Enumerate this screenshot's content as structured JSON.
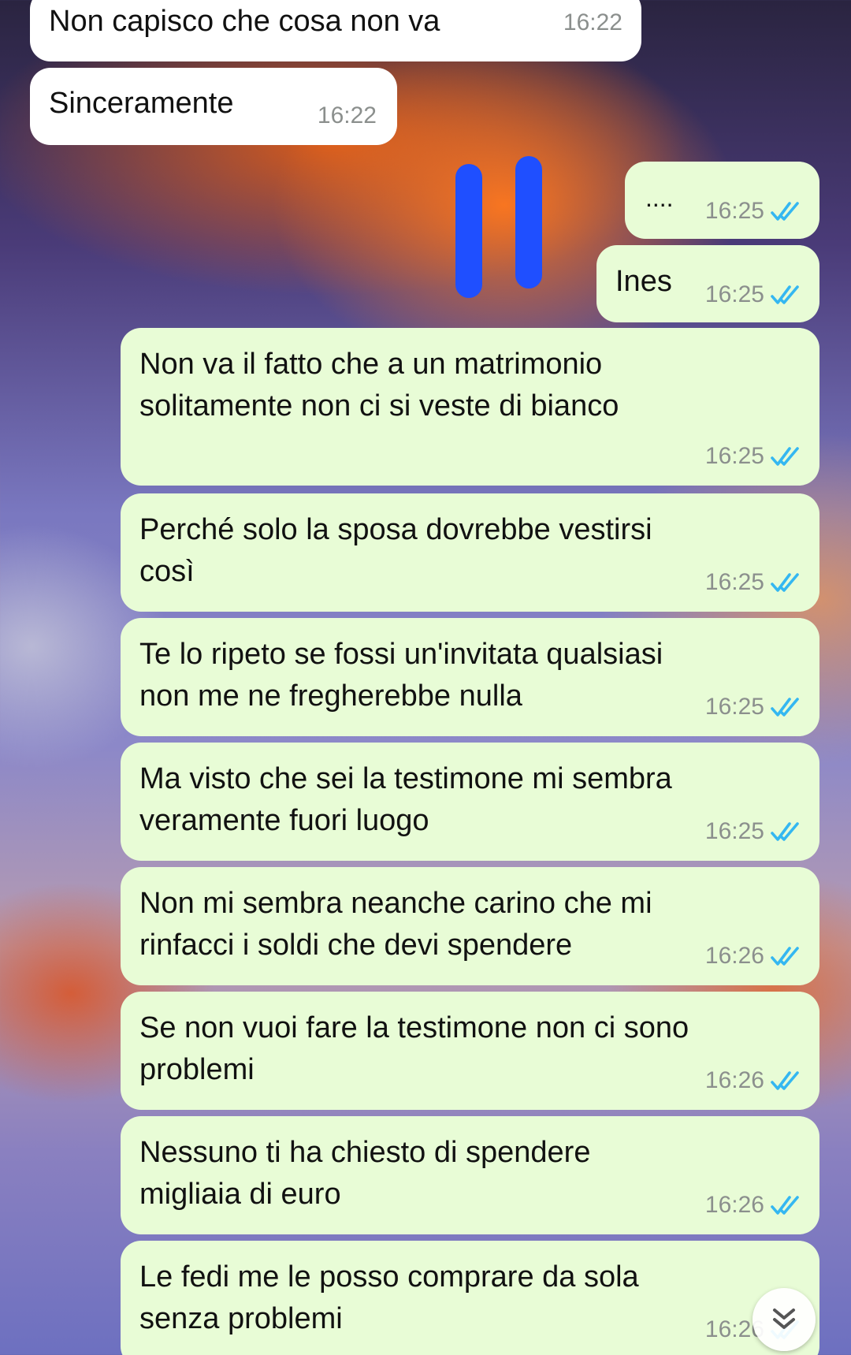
{
  "chat": {
    "messages": [
      {
        "direction": "incoming",
        "text": "Non capisco che cosa non va",
        "time": "16:22"
      },
      {
        "direction": "incoming",
        "text": "Sinceramente",
        "time": "16:22"
      },
      {
        "direction": "outgoing",
        "text": "....",
        "time": "16:25",
        "status": "read"
      },
      {
        "direction": "outgoing",
        "text": "Ines",
        "time": "16:25",
        "status": "read"
      },
      {
        "direction": "outgoing",
        "text": "Non va il fatto che a un matrimonio\nsolitamente non ci si veste di bianco",
        "time": "16:25",
        "status": "read"
      },
      {
        "direction": "outgoing",
        "text": "Perché solo la sposa dovrebbe vestirsi\ncosì",
        "time": "16:25",
        "status": "read"
      },
      {
        "direction": "outgoing",
        "text": "Te lo ripeto se fossi un'invitata qualsiasi\nnon me ne fregherebbe nulla",
        "time": "16:25",
        "status": "read"
      },
      {
        "direction": "outgoing",
        "text": "Ma visto che sei la testimone mi sembra\nveramente fuori luogo",
        "time": "16:25",
        "status": "read"
      },
      {
        "direction": "outgoing",
        "text": "Non mi sembra neanche carino che mi\nrinfacci i soldi che devi spendere",
        "time": "16:26",
        "status": "read"
      },
      {
        "direction": "outgoing",
        "text": "Se non vuoi fare la testimone non ci sono\nproblemi",
        "time": "16:26",
        "status": "read"
      },
      {
        "direction": "outgoing",
        "text": "Nessuno ti ha chiesto di spendere\nmigliaia di euro",
        "time": "16:26",
        "status": "read"
      },
      {
        "direction": "outgoing",
        "text": "Le fedi me le posso comprare da sola\nsenza problemi",
        "time": "16:26",
        "status": "read"
      }
    ],
    "scroll_button_icon": "double-chevron-down-icon"
  },
  "colors": {
    "incoming_bubble": "#ffffff",
    "outgoing_bubble": "#e8fcd6",
    "read_ticks": "#34b7f1",
    "timestamp": "#8b8f8d",
    "scribble": "#1f4fff"
  }
}
